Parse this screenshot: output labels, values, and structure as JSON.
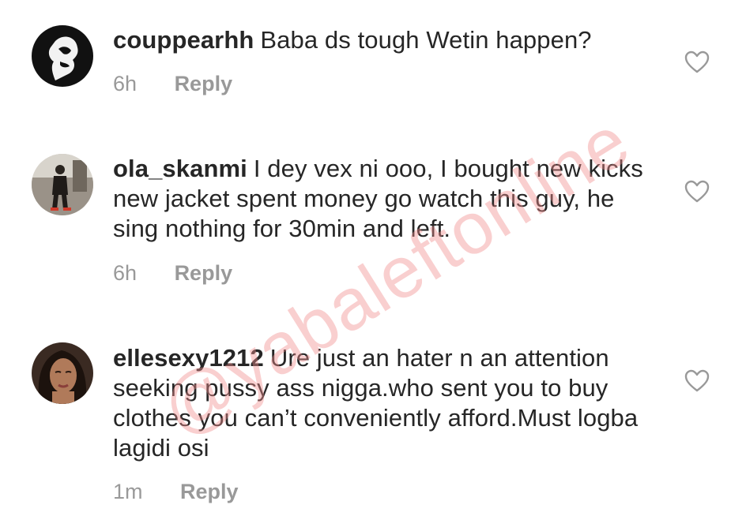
{
  "comments": [
    {
      "username": "couppearhh",
      "text": "Baba ds tough Wetin happen?",
      "time": "6h",
      "reply_label": "Reply",
      "avatar_icon": "silhouette-avatar"
    },
    {
      "username": "ola_skanmi",
      "text": "I dey vex ni ooo, I bought new kicks new jacket spent money go watch this guy, he sing nothing for 30min and left.",
      "time": "6h",
      "reply_label": "Reply",
      "avatar_icon": "photo-avatar"
    },
    {
      "username": "ellesexy1212",
      "text": "Ure just an hater n an attention seeking pussy ass nigga.who sent you to buy clothes you can’t conveniently afford.Must logba lagidi osi",
      "time": "1m",
      "reply_label": "Reply",
      "avatar_icon": "photo-avatar"
    }
  ],
  "watermark": "@yabaleftonline",
  "colors": {
    "text": "#262626",
    "meta": "#999999",
    "heart_outline": "#999999",
    "watermark": "#f08c8c"
  }
}
